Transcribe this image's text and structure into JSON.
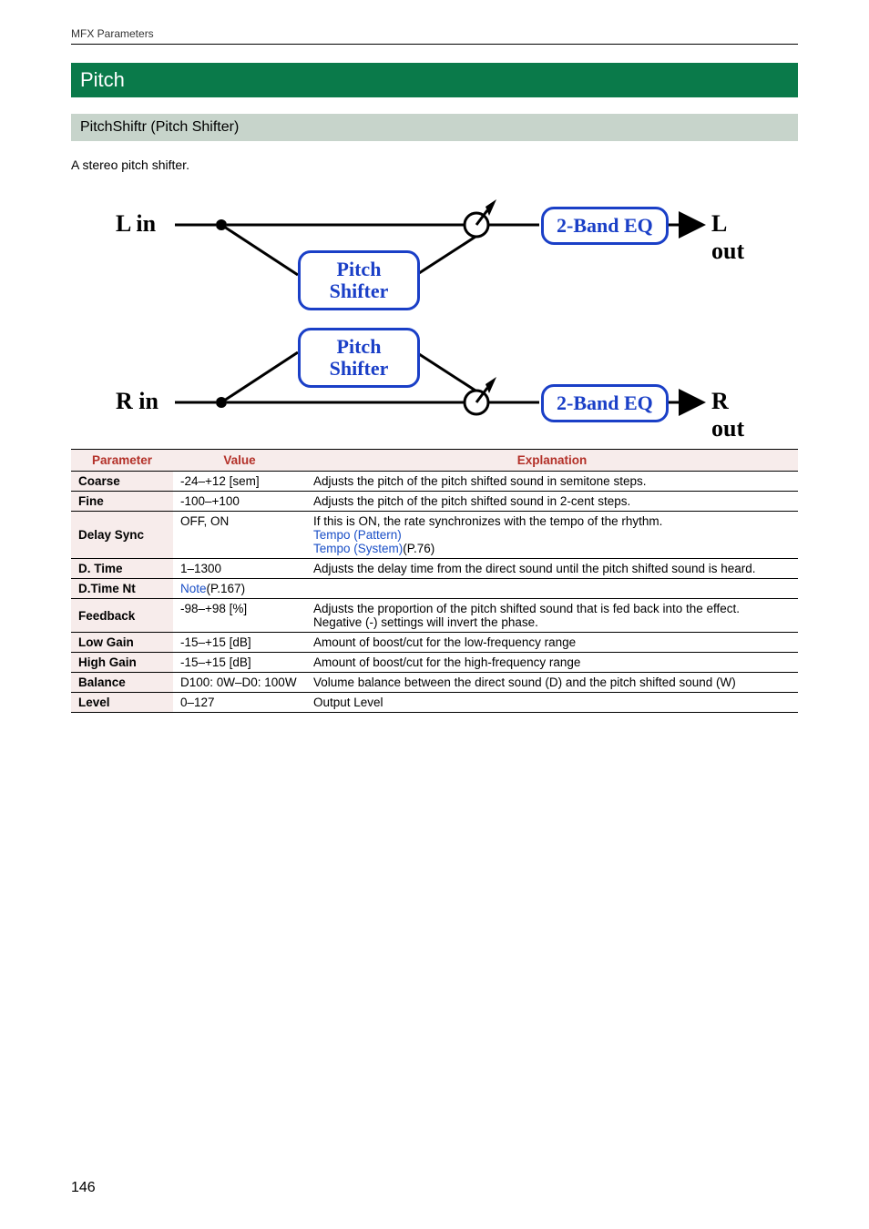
{
  "header": {
    "label": "MFX Parameters"
  },
  "section": "Pitch",
  "subsection": "PitchShiftr (Pitch Shifter)",
  "intro": "A stereo pitch shifter.",
  "diagram": {
    "l_in": "L in",
    "r_in": "R in",
    "l_out": "L out",
    "r_out": "R out",
    "pitch_shifter": "Pitch\nShifter",
    "eq": "2-Band EQ"
  },
  "table": {
    "headers": {
      "param": "Parameter",
      "value": "Value",
      "explain": "Explanation"
    },
    "rows": [
      {
        "param": "Coarse",
        "value": "-24–+12 [sem]",
        "explain": "Adjusts the pitch of the pitch shifted sound in semitone steps."
      },
      {
        "param": "Fine",
        "value": "-100–+100",
        "explain": "Adjusts the pitch of the pitch shifted sound in 2-cent steps."
      },
      {
        "param": "Delay Sync",
        "value": "OFF, ON",
        "explain_pre": "If this is ON, the rate synchronizes with the tempo of the rhythm.",
        "link1": "Tempo (Pattern)",
        "link2": "Tempo (System)",
        "link2_suffix": "(P.76)"
      },
      {
        "param": "D. Time",
        "value": "1–1300",
        "explain": "Adjusts the delay time from the direct sound until the pitch shifted sound is heard."
      },
      {
        "param": "D.Time Nt",
        "value_link": "Note",
        "value_suffix": "(P.167)",
        "explain": ""
      },
      {
        "param": "Feedback",
        "value": "-98–+98 [%]",
        "explain": "Adjusts the proportion of the pitch shifted sound that is fed back into the effect.",
        "explain2": "Negative (-) settings will invert the phase."
      },
      {
        "param": "Low Gain",
        "value": "-15–+15 [dB]",
        "explain": "Amount of boost/cut for the low-frequency range"
      },
      {
        "param": "High Gain",
        "value": "-15–+15 [dB]",
        "explain": "Amount of boost/cut for the high-frequency range"
      },
      {
        "param": "Balance",
        "value": "D100: 0W–D0: 100W",
        "explain": "Volume balance between the direct sound (D) and the pitch shifted sound (W)"
      },
      {
        "param": "Level",
        "value": "0–127",
        "explain": "Output Level"
      }
    ]
  },
  "page_num": "146"
}
